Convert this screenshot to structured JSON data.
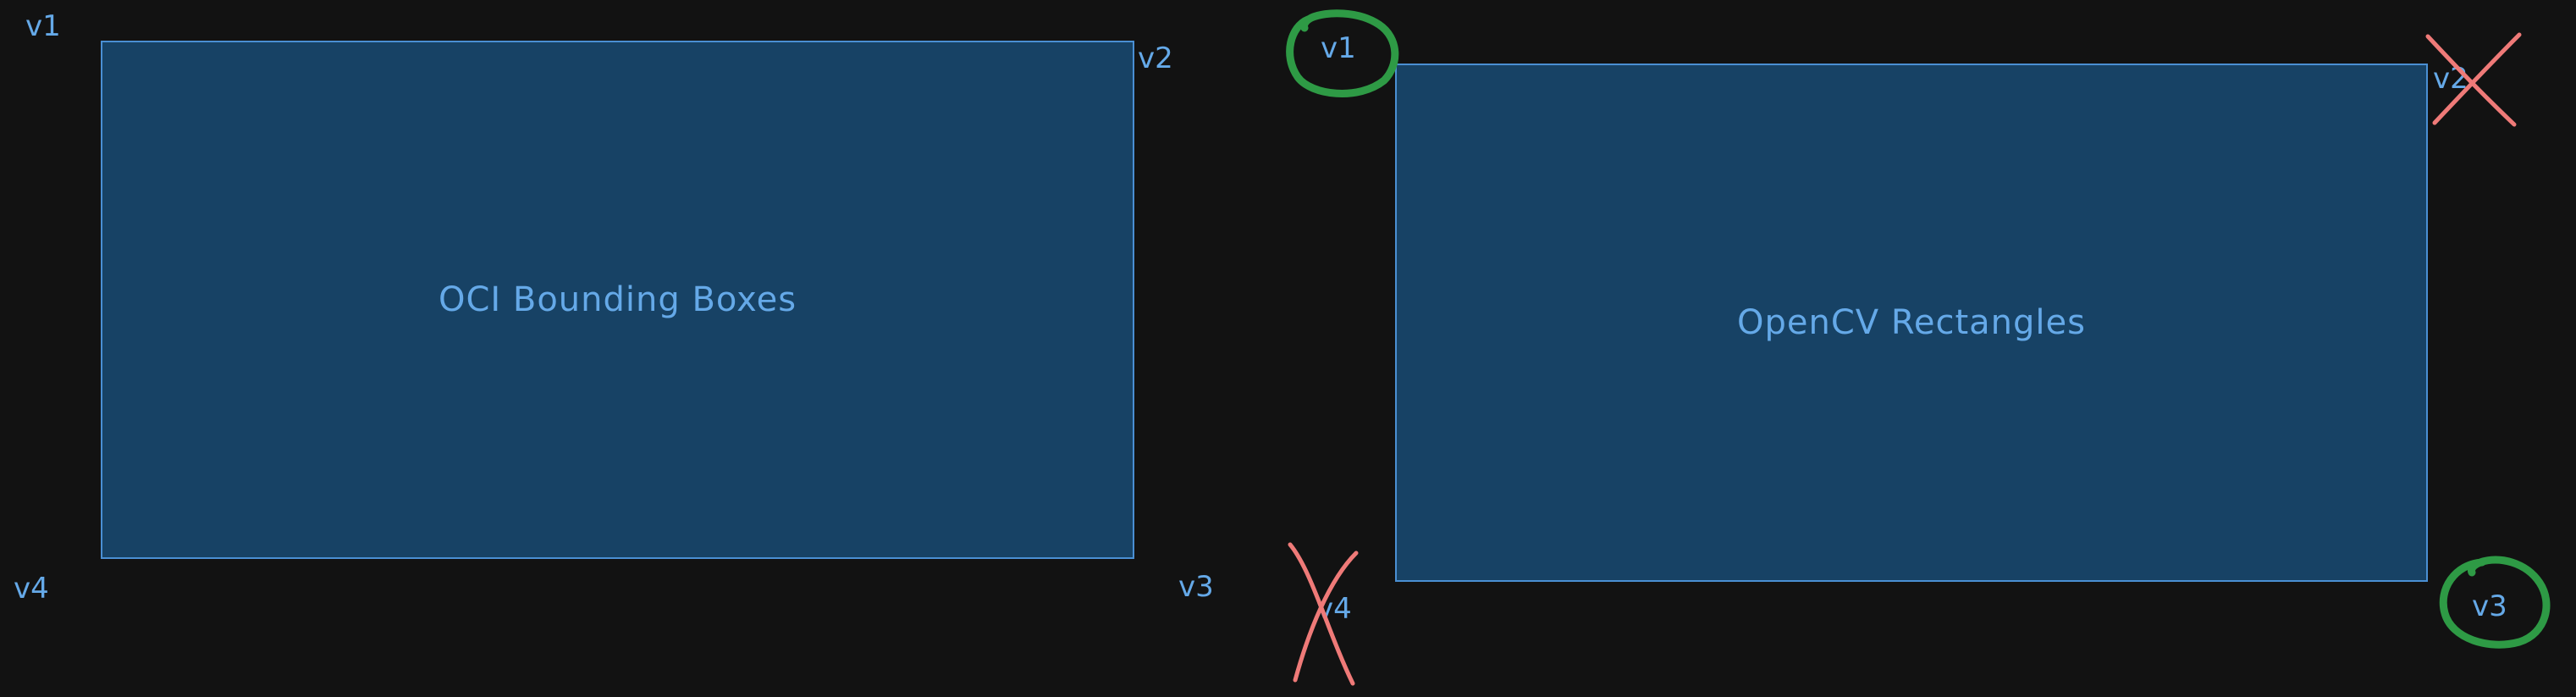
{
  "colors": {
    "background": "#121212",
    "box_fill": "#174265",
    "box_stroke": "#4a8fd3",
    "text": "#65a9e8",
    "keep_circle": "#2e9a45",
    "reject_cross": "#ef7a78"
  },
  "diagram": {
    "left_box": {
      "title": "OCI Bounding Boxes",
      "vertices": {
        "v1": "v1",
        "v2": "v2",
        "v3": "v3",
        "v4": "v4"
      }
    },
    "right_box": {
      "title": "OpenCV Rectangles",
      "vertices": {
        "v1": "v1",
        "v2": "v2",
        "v3": "v3",
        "v4": "v4"
      },
      "kept_vertex_marks": [
        "v1",
        "v3"
      ],
      "rejected_vertex_marks": [
        "v2",
        "v4"
      ]
    }
  }
}
